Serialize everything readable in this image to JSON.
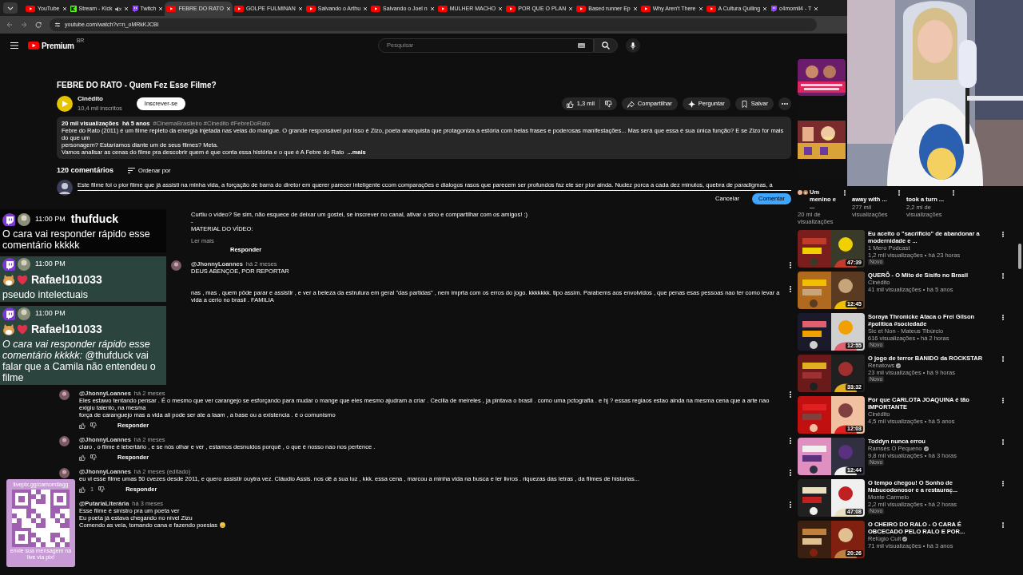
{
  "browser": {
    "tabs": [
      {
        "label": "YouTube",
        "kind": "youtube",
        "selected": false,
        "muted": false
      },
      {
        "label": "Stream - Kick",
        "kind": "kick",
        "selected": false,
        "muted": true
      },
      {
        "label": "Twitch",
        "kind": "twitch",
        "selected": false,
        "muted": false
      },
      {
        "label": "FEBRE DO RATO",
        "kind": "youtube",
        "selected": true,
        "muted": false
      },
      {
        "label": "GOLPE FULMINAN",
        "kind": "youtube",
        "selected": false,
        "muted": false
      },
      {
        "label": "Salvando o Arthu",
        "kind": "youtube",
        "selected": false,
        "muted": false
      },
      {
        "label": "Salvando o Joel n",
        "kind": "youtube",
        "selected": false,
        "muted": false
      },
      {
        "label": "MULHER MACHO",
        "kind": "youtube",
        "selected": false,
        "muted": false
      },
      {
        "label": "POR QUE O PLAN",
        "kind": "youtube",
        "selected": false,
        "muted": false
      },
      {
        "label": "Based runner Ep",
        "kind": "youtube",
        "selected": false,
        "muted": false
      },
      {
        "label": "Why Aren't There",
        "kind": "youtube",
        "selected": false,
        "muted": false
      },
      {
        "label": "A Cultura Quiling",
        "kind": "youtube",
        "selected": false,
        "muted": false
      },
      {
        "label": "c4momil4 - T",
        "kind": "twitch",
        "selected": false,
        "muted": false
      }
    ],
    "address": "youtube.com/watch?v=n_oMRkKJCBI"
  },
  "header": {
    "logo": "Premium",
    "region": "BR",
    "search_placeholder": "Pesquisar"
  },
  "video": {
    "title": "FEBRE DO RATO - Quem Fez Esse Filme?",
    "channel": "Cinédito",
    "subscribers": "10,4 mil inscritos",
    "subscribe": "Inscrever-se",
    "likes": "1,3 mil",
    "actions": [
      {
        "kind": "share",
        "label": "Compartilhar"
      },
      {
        "kind": "ask",
        "label": "Perguntar"
      },
      {
        "kind": "save",
        "label": "Salvar"
      }
    ],
    "description": {
      "stats": "20 mil visualizações  há 5 anos",
      "hashtags": "#CinemaBrasileiro #Cinedito #FebreDoRato",
      "lines": [
        "Febre do Rato (2011) é um filme repleto da energia injetada nas veias do mangue. O grande responsável por isso é Zizo, poeta anarquista que protagoniza a estória com belas frases e poderosas manifestações... Mas será que essa é sua única função? E se Zizo for mais do que um",
        "personagem? Estaríamos diante um de seus filmes? Meta.",
        "Vamos analisar as cenas do filme pra descobrir quem é que conta essa história e o que é A Febre do Rato"
      ],
      "more": "...mais"
    }
  },
  "comments": {
    "count": "120 comentários",
    "sort": "Ordenar por",
    "composer": {
      "value": "Este filme foi o pior filme que já assisti na minha vida,  a forçação de barra do diretor em querer parecer inteligente ccom comparações e dialogos rasos que parecem ser profundos faz ele ser pior ainda. Nudez porca a cada dez minutos, quebra de paradigmas, a",
      "cancel": "Cancelar",
      "submit": "Comentar"
    },
    "items": [
      {
        "kind": "covered",
        "lines": [
          "Curtiu o vídeo? Se sim, não esquece de deixar um gostei, se inscrever no canal, ativar o sino e compartilhar com os amigos! :)",
          "-",
          "MATERIAL DO VÍDEO:"
        ],
        "read_more": "Ler mais",
        "reply": "Responder"
      },
      {
        "kind": "full",
        "author": "@JhonnyLoannes",
        "time": "há 2 meses",
        "lines": [
          "DEUS ABENÇOE,  POR REPORTAR"
        ]
      },
      {
        "kind": "clipped",
        "lines": [
          "nas , mas , quem pôde parar e  assistir , e ver a beleza da estrutura em geral \"das partidas\"  , nem imprta com os erros do jogo. kkkkkkk.  tipo assim. Parabems aos envolvidos , que penas esas pessoas nao ter como levar a vida a cerio no brasil . FAMILIA"
        ]
      },
      {
        "kind": "full",
        "author": "@JhonnyLoannes",
        "time": "há 2 meses",
        "lines": [
          "Eles estawo tentando pensar . É o mesmo que ver carangejo se esforçando para mudar o mange que eles mesmo ajudram a criar . Cecilia de meireles , ja pintava o brasil . como uma pctografia . e hj ? essas regiaos estao ainda na mesma cena que a arte nao exigiu talento,  na mesma",
          "força de caranguejo mas  a vida ali pode ser ate a laam , a base ou a existencia . é o comunismo"
        ],
        "reply": "Responder"
      },
      {
        "kind": "full",
        "author": "@JhonnyLoannes",
        "time": "há 2 meses",
        "lines": [
          "claro , o filme é lebertário , e se nós olhar e ver , estamos desnuidos porquê , o que é nosso nao nos pertence ."
        ],
        "reply": "Responder"
      },
      {
        "kind": "full",
        "author": "@JhonnyLoannes",
        "time": "há 2 meses (editado)",
        "lines": [
          "eu vi esse filme umas 50 cvezes desde 2011, e quero assistir ouytra vez. Cláudio Assis. nos dê a sua luz , kkk. essa cena , marcou a minha vida na busca  e ler livros . riquezas das letras , da filmes de historias..."
        ],
        "likes": "1",
        "reply": "Responder"
      },
      {
        "kind": "full",
        "author": "@PutariaLiterária",
        "time": "há 3 meses",
        "lines": [
          "Esse filme é sinistro pra um poeta ver",
          "Eu poeta já estava chegando no nível Zizu",
          "Comendo as veia, tomando cana e fazendo poesias"
        ],
        "smile": true
      }
    ]
  },
  "sidebar": {
    "shorts": [
      {
        "title": "Um menino e ...",
        "views": "20 mi de visualizações"
      },
      {
        "title": "away with ...",
        "views": "277 mil visualizações"
      },
      {
        "title": "took a turn ...",
        "views": "2,2 mi de visualizações"
      }
    ],
    "videos": [
      {
        "title": "Eu aceito o \"sacrifício\" de abandonar a modernidade e ...",
        "channel": "1 Mero Podcast",
        "verified": false,
        "meta": "1,2 mil visualizações • há 23 horas",
        "badge": "Novo",
        "duration": "47:39"
      },
      {
        "title": "QUERÔ - O Mito de Sísifo no Brasil",
        "channel": "Cinédito",
        "verified": false,
        "meta": "41 mil visualizações • há 5 anos",
        "duration": "12:45"
      },
      {
        "title": "Soraya Thronicke Ataca o Frei Gilson #politica #sociedade",
        "channel": "Sic et Non - Mateus Tibúrcio",
        "verified": false,
        "meta": "616 visualizações • há 2 horas",
        "badge": "Novo",
        "duration": "12:55"
      },
      {
        "title": "O jogo de terror BANIDO da ROCKSTAR",
        "channel": "Renatows",
        "verified": true,
        "meta": "23 mil visualizações • há 9 horas",
        "badge": "Novo",
        "duration": "33:32"
      },
      {
        "title": "Por que CARLOTA JOAQUINA é tão IMPORTANTE",
        "channel": "Cinédito",
        "verified": false,
        "meta": "4,5 mil visualizações • há 5 anos",
        "duration": "12:03"
      },
      {
        "title": "Toddyn nunca errou",
        "channel": "Ramsés O Pequeno",
        "verified": true,
        "meta": "9,8 mil visualizações • há 3 horas",
        "badge": "Novo",
        "duration": "12:44"
      },
      {
        "title": "O tempo chegou! O Sonho de Nabucodonosor e a restauraç...",
        "channel": "Monte Carmelo",
        "verified": false,
        "meta": "2,2 mil visualizações • há 2 horas",
        "badge": "Novo",
        "duration": "47:08"
      },
      {
        "title": "O CHEIRO DO RALO - O CARA É OBCECADO PELO RALO E POR...",
        "channel": "Refúgio Cult",
        "verified": true,
        "meta": "71 mil visualizações • há 3 anos",
        "duration": "20:26"
      }
    ]
  },
  "chat_overlay": {
    "messages": [
      {
        "time": "11:00 PM",
        "user": "thufduck",
        "badges": false,
        "text": "O cara vai responder rápido esse comentário kkkkk"
      },
      {
        "time": "11:00 PM",
        "user": "Rafael101033",
        "badges": true,
        "text": "pseudo intelectuais"
      },
      {
        "time": "11:00 PM",
        "user": "Rafael101033",
        "badges": true,
        "text": "*O cara vai responder rápido esse comentário kkkkk:* @thufduck vai falar que a Camila não entendeu o filme"
      }
    ]
  },
  "donation_overlay": {
    "url": "livepix.gg/camomilagg",
    "caption": "envie sua mensagem na live via pix!"
  }
}
